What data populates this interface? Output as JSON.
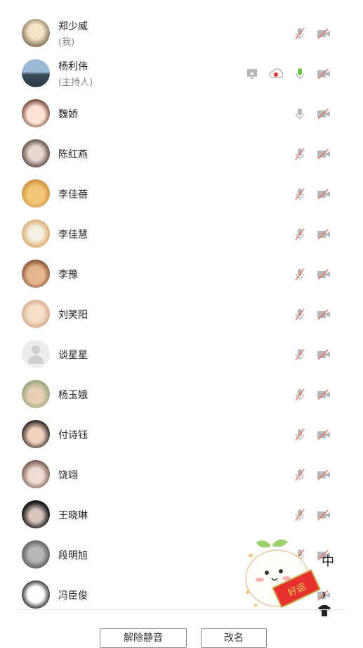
{
  "participants": [
    {
      "name": "郑少威",
      "role": "(我)",
      "avatar": "dog-photo",
      "icons": [
        "mic-muted-icon",
        "camera-off-icon"
      ]
    },
    {
      "name": "杨利伟",
      "role": "(主持人)",
      "avatar": "city-photo",
      "icons": [
        "screen-share-icon",
        "cloud-record-icon",
        "mic-active-icon",
        "camera-off-icon"
      ]
    },
    {
      "name": "魏娇",
      "role": "",
      "avatar": "cartoon-girl",
      "icons": [
        "mic-icon",
        "camera-off-icon"
      ]
    },
    {
      "name": "陈红燕",
      "role": "",
      "avatar": "child-photo",
      "icons": [
        "mic-muted-icon",
        "camera-off-icon"
      ]
    },
    {
      "name": "李佳蓓",
      "role": "",
      "avatar": "puppy-photo",
      "icons": [
        "mic-muted-icon",
        "camera-off-icon"
      ]
    },
    {
      "name": "李佳慧",
      "role": "",
      "avatar": "cat-photo",
      "icons": [
        "mic-muted-icon",
        "camera-off-icon"
      ]
    },
    {
      "name": "李豫",
      "role": "",
      "avatar": "cartoon-boy",
      "icons": [
        "mic-muted-icon",
        "camera-off-icon"
      ]
    },
    {
      "name": "刘笑阳",
      "role": "",
      "avatar": "anime-girl",
      "icons": [
        "mic-muted-icon",
        "camera-off-icon"
      ]
    },
    {
      "name": "谈星星",
      "role": "",
      "avatar": "default",
      "icons": [
        "mic-muted-icon",
        "camera-off-icon"
      ]
    },
    {
      "name": "杨玉娥",
      "role": "",
      "avatar": "outdoor-photo",
      "icons": [
        "mic-muted-icon",
        "camera-off-icon"
      ]
    },
    {
      "name": "付诗钰",
      "role": "",
      "avatar": "girl-photo",
      "icons": [
        "mic-muted-icon",
        "camera-off-icon"
      ]
    },
    {
      "name": "饶翊",
      "role": "",
      "avatar": "woman-photo",
      "icons": [
        "mic-muted-icon",
        "camera-off-icon"
      ]
    },
    {
      "name": "王晓琳",
      "role": "",
      "avatar": "dark-photo",
      "icons": [
        "mic-muted-icon",
        "camera-off-icon"
      ]
    },
    {
      "name": "段明旭",
      "role": "",
      "avatar": "gray-photo",
      "icons": [
        "mic-muted-icon",
        "camera-off-icon"
      ]
    },
    {
      "name": "冯臣俊",
      "role": "",
      "avatar": "sketch-avatar",
      "icons": [
        "mic-muted-icon",
        "camera-off-icon"
      ]
    }
  ],
  "buttons": {
    "unmute_all": "解除静音",
    "rename": "改名"
  },
  "sticker": {
    "text": "中",
    "banner": "好运"
  }
}
